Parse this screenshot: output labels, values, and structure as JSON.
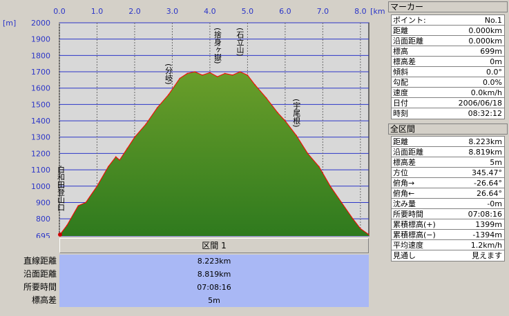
{
  "chart": {
    "x_unit": "[km]",
    "y_unit": "[m]",
    "x_ticks": [
      "0.0",
      "1.0",
      "2.0",
      "3.0",
      "4.0",
      "5.0",
      "6.0",
      "7.0",
      "8.0"
    ],
    "y_ticks": [
      "2000",
      "1900",
      "1800",
      "1700",
      "1600",
      "1500",
      "1400",
      "1300",
      "1200",
      "1100",
      "1000",
      "900",
      "800",
      "695"
    ],
    "annotations": [
      {
        "label": "白和田登山口",
        "km": 0.0
      },
      {
        "label": "(分岐)",
        "km": 2.9
      },
      {
        "label": "(捨身ヶ嶽)",
        "km": 4.2
      },
      {
        "label": "(石立山)",
        "km": 4.8
      },
      {
        "label": "(宇尾根)",
        "km": 6.3
      }
    ],
    "colors": {
      "fill_top": "#6a9e2a",
      "fill_bottom": "#2f7a1e",
      "line": "#ff0000",
      "grid": "#2b35c8",
      "bg": "#d4d0c8"
    }
  },
  "chart_data": {
    "type": "area",
    "xlabel": "[km]",
    "ylabel": "[m]",
    "xlim": [
      0,
      8.223
    ],
    "ylim": [
      695,
      2000
    ],
    "x": [
      0,
      0.2,
      0.5,
      0.7,
      1.0,
      1.3,
      1.5,
      1.6,
      1.8,
      2.0,
      2.3,
      2.6,
      2.9,
      3.2,
      3.4,
      3.6,
      3.8,
      4.0,
      4.2,
      4.4,
      4.6,
      4.8,
      5.0,
      5.2,
      5.5,
      5.8,
      6.0,
      6.3,
      6.6,
      6.9,
      7.2,
      7.5,
      7.8,
      8.0,
      8.223
    ],
    "values": [
      699,
      760,
      880,
      900,
      1000,
      1120,
      1180,
      1160,
      1230,
      1300,
      1380,
      1480,
      1560,
      1660,
      1690,
      1700,
      1680,
      1695,
      1670,
      1690,
      1680,
      1700,
      1680,
      1620,
      1540,
      1450,
      1400,
      1310,
      1200,
      1120,
      1000,
      900,
      800,
      740,
      704
    ]
  },
  "section": {
    "title": "区間 1"
  },
  "summary": {
    "labels": [
      "直線距離",
      "沿面距離",
      "所要時間",
      "標高差"
    ],
    "values": [
      "8.223km",
      "8.819km",
      "07:08:16",
      "5m"
    ]
  },
  "marker_panel": {
    "title": "マーカー",
    "rows": [
      {
        "k": "ポイント:",
        "v": "No.1"
      },
      {
        "k": "距離",
        "v": "0.000km"
      },
      {
        "k": "沿面距離",
        "v": "0.000km"
      },
      {
        "k": "標高",
        "v": "699m"
      },
      {
        "k": "標高差",
        "v": "0m"
      },
      {
        "k": "傾斜",
        "v": "0.0°"
      },
      {
        "k": "勾配",
        "v": "0.0%"
      },
      {
        "k": "速度",
        "v": "0.0km/h"
      },
      {
        "k": "日付",
        "v": "2006/06/18"
      },
      {
        "k": "時刻",
        "v": "08:32:12"
      }
    ]
  },
  "section_panel": {
    "title": "全区間",
    "rows": [
      {
        "k": "距離",
        "v": "8.223km"
      },
      {
        "k": "沿面距離",
        "v": "8.819km"
      },
      {
        "k": "標高差",
        "v": "5m"
      },
      {
        "k": "方位",
        "v": "345.47°"
      },
      {
        "k": "俯角→",
        "v": "-26.64°"
      },
      {
        "k": "俯角←",
        "v": "26.64°"
      },
      {
        "k": "沈み量",
        "v": "-0m"
      },
      {
        "k": "所要時間",
        "v": "07:08:16"
      },
      {
        "k": "累積標高(+)",
        "v": "1399m"
      },
      {
        "k": "累積標高(−)",
        "v": "-1394m"
      },
      {
        "k": "平均速度",
        "v": "1.2km/h"
      },
      {
        "k": "見通し",
        "v": "見えます"
      }
    ]
  }
}
